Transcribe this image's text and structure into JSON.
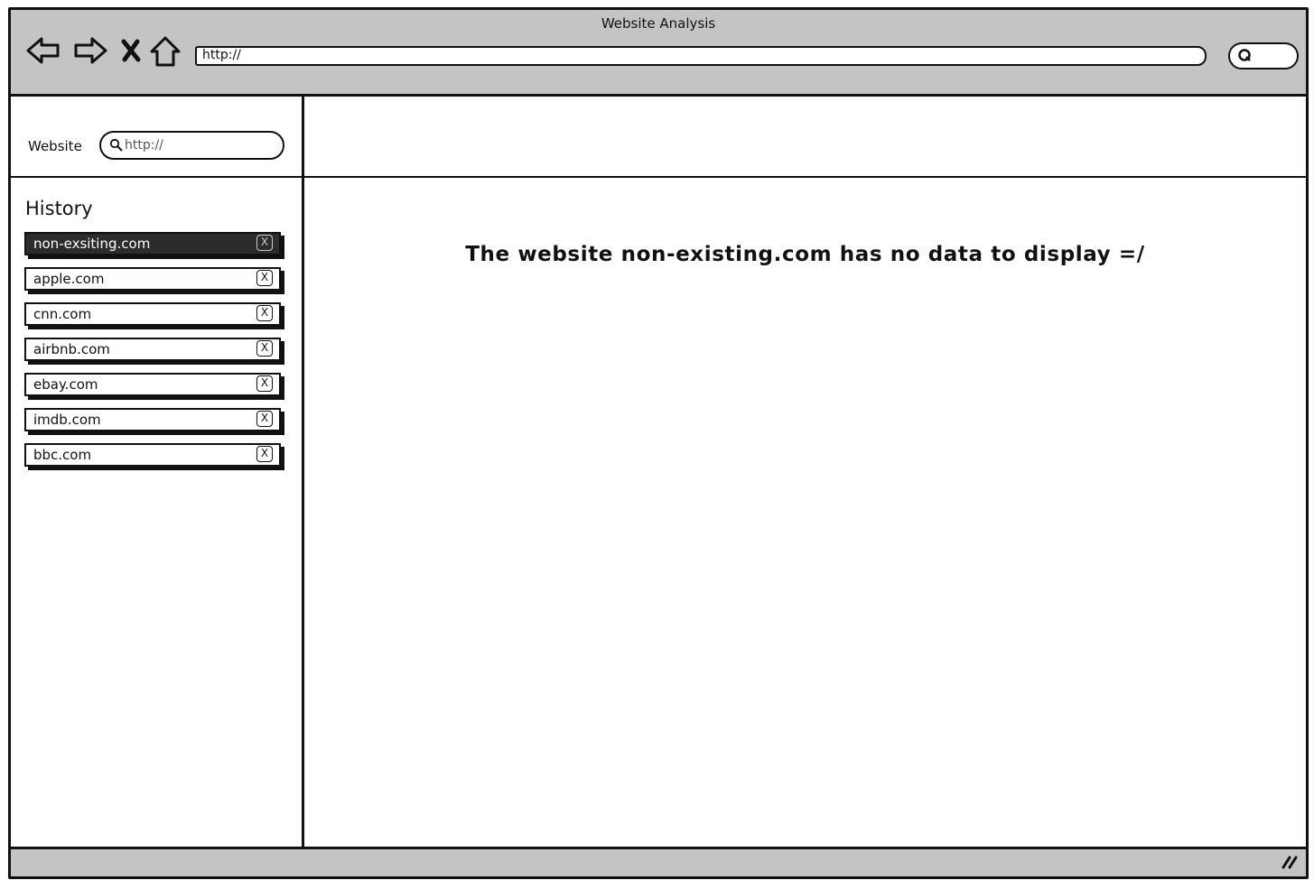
{
  "window": {
    "title": "Website Analysis",
    "address_value": "http://"
  },
  "toolbar": {
    "icons": [
      "back-arrow-icon",
      "forward-arrow-icon",
      "stop-icon",
      "home-icon",
      "search-icon"
    ]
  },
  "sidebar": {
    "website_label": "Website",
    "website_search_value": "http://",
    "history_title": "History",
    "history_items": [
      {
        "label": "non-exsiting.com",
        "close": "X",
        "selected": true
      },
      {
        "label": "apple.com",
        "close": "X",
        "selected": false
      },
      {
        "label": "cnn.com",
        "close": "X",
        "selected": false
      },
      {
        "label": "airbnb.com",
        "close": "X",
        "selected": false
      },
      {
        "label": "ebay.com",
        "close": "X",
        "selected": false
      },
      {
        "label": "imdb.com",
        "close": "X",
        "selected": false
      },
      {
        "label": "bbc.com",
        "close": "X",
        "selected": false
      }
    ]
  },
  "main": {
    "message": "The website non-existing.com has no data to display =/"
  },
  "colors": {
    "chrome_gray": "#c4c4c4",
    "selected_bg": "#2c2c2c",
    "ink": "#111111"
  }
}
